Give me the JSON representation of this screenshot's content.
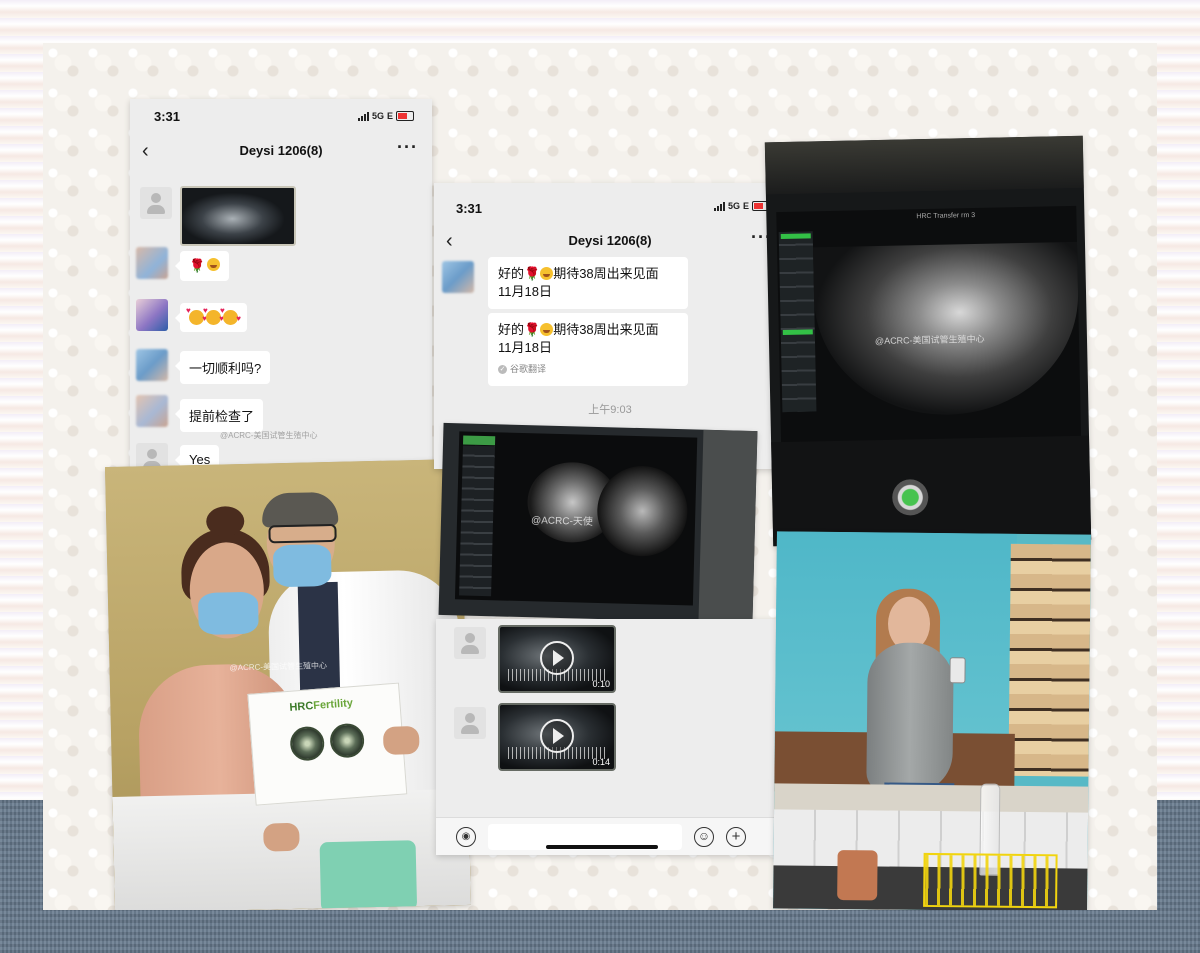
{
  "chat1": {
    "status_time": "3:31",
    "network": "5G",
    "network_suffix": "E",
    "title": "Deysi 1206(8)",
    "messages": [
      {
        "type": "image"
      },
      {
        "type": "emoji"
      },
      {
        "type": "emoji"
      },
      {
        "type": "text",
        "text": "一切顺利吗?"
      },
      {
        "type": "text",
        "text": "提前检查了"
      },
      {
        "type": "text",
        "text": "Yes"
      }
    ]
  },
  "chat2": {
    "status_time": "3:31",
    "network": "5G",
    "network_suffix": "E",
    "title": "Deysi 1206(8)",
    "message_1": {
      "prefix": "好的",
      "text": "期待38周出来见面",
      "line2": "11月18日"
    },
    "message_2": {
      "prefix": "好的",
      "text": "期待38周出来见面",
      "line2": "11月18日",
      "translate_tag": "谷歌翻译"
    },
    "time_divider": "上午9:03"
  },
  "chat3": {
    "videos": [
      {
        "duration": "0:10"
      },
      {
        "duration": "0:14"
      }
    ],
    "input": {
      "value": "",
      "placeholder": ""
    }
  },
  "watermarks": {
    "chat1": "@ACRC-美国试管生殖中心",
    "middle": "@ACRC-天使",
    "right": "@ACRC-美国试管生殖中心",
    "doctor": "@ACRC-美国试管生殖中心"
  },
  "doctor_photo": {
    "card_logo_prefix": "HRC",
    "card_logo_suffix": "Fertility",
    "coat_text": "HRC Fertility"
  },
  "us_right": {
    "header_text": "HRC Transfer rm 3"
  },
  "colors": {
    "chat_bg": "#ededed",
    "bubble_bg": "#ffffff",
    "accent_green": "#33c046",
    "hrc_green": "#6aa63a"
  }
}
